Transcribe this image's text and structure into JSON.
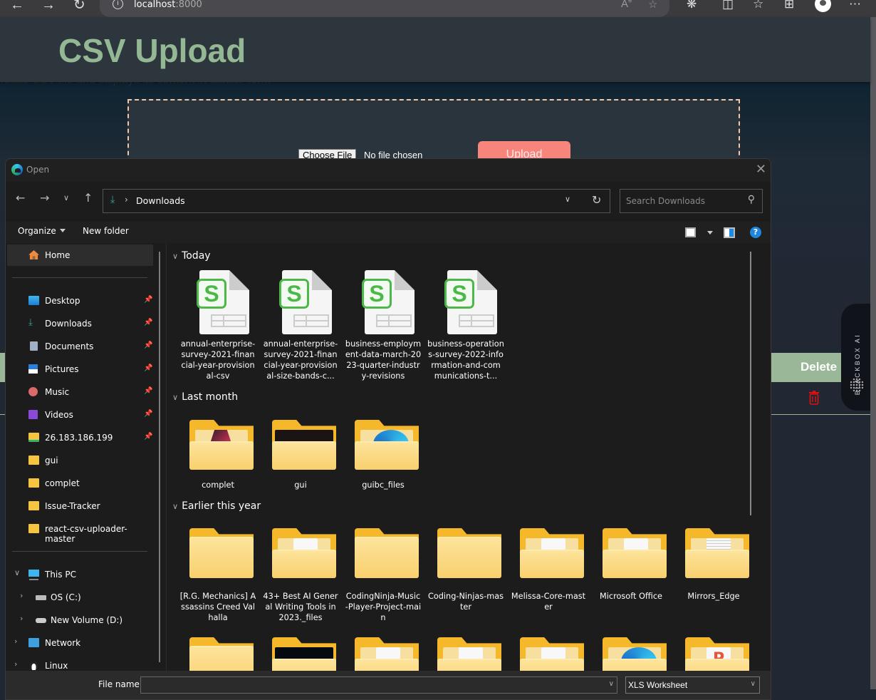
{
  "browser": {
    "url_host": "localhost",
    "url_port": ":8000",
    "icons": [
      "back-icon",
      "forward-icon",
      "refresh-icon",
      "info-icon",
      "read-aloud-icon",
      "favorite-icon",
      "extensions-icon",
      "split-screen-icon",
      "favorites-icon",
      "collections-icon",
      "profile-icon",
      "more-icon"
    ]
  },
  "page": {
    "title": "CSV Upload",
    "subtitle": "Reads CSV file and displays its content in tabular form",
    "choose_file_label": "Choose File",
    "no_file_text": "No file chosen",
    "upload_label": "Upload",
    "table_header_delete": "Delete",
    "blackbox_label": "BLACKBOX AI"
  },
  "dialog": {
    "title": "Open",
    "breadcrumb": "Downloads",
    "search_placeholder": "Search Downloads",
    "organize_label": "Organize",
    "new_folder_label": "New folder",
    "sidebar": {
      "home": "Home",
      "quick_access": [
        {
          "label": "Desktop",
          "icon": "desktop-icon",
          "pinned": true
        },
        {
          "label": "Downloads",
          "icon": "download-icon",
          "pinned": true
        },
        {
          "label": "Documents",
          "icon": "documents-icon",
          "pinned": true
        },
        {
          "label": "Pictures",
          "icon": "pictures-icon",
          "pinned": true
        },
        {
          "label": "Music",
          "icon": "music-icon",
          "pinned": true
        },
        {
          "label": "Videos",
          "icon": "videos-icon",
          "pinned": true
        },
        {
          "label": "26.183.186.199",
          "icon": "network-folder-icon",
          "pinned": true
        },
        {
          "label": "gui",
          "icon": "folder-icon",
          "pinned": false
        },
        {
          "label": "complet",
          "icon": "folder-icon",
          "pinned": false
        },
        {
          "label": "Issue-Tracker",
          "icon": "folder-icon",
          "pinned": false
        },
        {
          "label": "react-csv-uploader-master",
          "icon": "folder-icon",
          "pinned": false
        }
      ],
      "this_pc": "This PC",
      "drives": [
        "OS (C:)",
        "New Volume (D:)"
      ],
      "network": "Network",
      "linux": "Linux"
    },
    "groups": [
      {
        "label": "Today",
        "items": [
          {
            "name": "annual-enterprise-survey-2021-financial-year-provisional-csv",
            "type": "spreadsheet"
          },
          {
            "name": "annual-enterprise-survey-2021-financial-year-provisional-size-bands-c...",
            "type": "spreadsheet"
          },
          {
            "name": "business-employment-data-march-2023-quarter-industry-revisions",
            "type": "spreadsheet"
          },
          {
            "name": "business-operations-survey-2022-information-and-communications-t...",
            "type": "spreadsheet"
          }
        ]
      },
      {
        "label": "Last month",
        "items": [
          {
            "name": "complet",
            "type": "folder"
          },
          {
            "name": "gui",
            "type": "folder"
          },
          {
            "name": "guibc_files",
            "type": "folder"
          }
        ]
      },
      {
        "label": "Earlier this year",
        "items": [
          {
            "name": "[R.G. Mechanics] Assassins Creed Valhalla",
            "type": "folder"
          },
          {
            "name": "43+ Best AI General Writing Tools in 2023._files",
            "type": "folder"
          },
          {
            "name": "CodingNinja-Music-Player-Project-main",
            "type": "folder"
          },
          {
            "name": "Coding-Ninjas-master",
            "type": "folder"
          },
          {
            "name": "Melissa-Core-master",
            "type": "folder"
          },
          {
            "name": "Microsoft Office",
            "type": "folder"
          },
          {
            "name": "Mirrors_Edge",
            "type": "folder"
          }
        ]
      }
    ],
    "file_name_label": "File name:",
    "file_name_value": "",
    "file_type": "XLS Worksheet"
  }
}
